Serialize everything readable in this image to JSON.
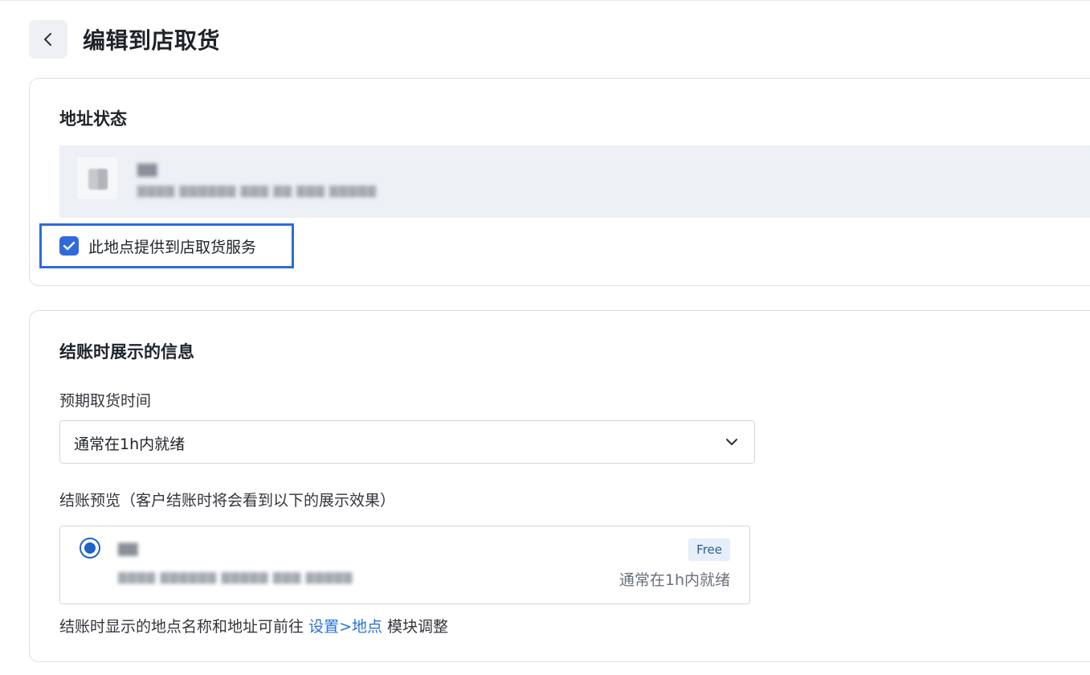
{
  "page": {
    "title": "编辑到店取货"
  },
  "address_status": {
    "section_title": "地址状态",
    "location_name": "▇▇",
    "location_address": "▇▇▇▇ ▇▇▇▇▇▇ ▇▇▇ ▇▇ ▇▇▇ ▇▇▇▇▇",
    "pickup_checkbox": {
      "label": "此地点提供到店取货服务",
      "checked": true
    }
  },
  "checkout_info": {
    "section_title": "结账时展示的信息",
    "pickup_time_label": "预期取货时间",
    "pickup_time_value": "通常在1h内就绪",
    "preview_label": "结账预览（客户结账时将会看到以下的展示效果）",
    "preview": {
      "name": "▇▇",
      "address": "▇▇▇▇ ▇▇▇▇▇▇ ▇▇▇▇▇ ▇▇▇ ▇▇▇▇▇",
      "badge": "Free",
      "time": "通常在1h内就绪"
    },
    "footnote_prefix": "结账时显示的地点名称和地址可前往",
    "footnote_link": "设置>地点",
    "footnote_suffix": "模块调整"
  },
  "colors": {
    "accent": "#2f6bdd",
    "highlight_border": "#2f6be0",
    "address_bg": "#edf0f5",
    "link": "#2872d9"
  },
  "icons": {
    "back": "chevron-left-icon",
    "checkbox": "check-icon",
    "select": "chevron-down-icon",
    "radio": "radio-selected-icon"
  }
}
